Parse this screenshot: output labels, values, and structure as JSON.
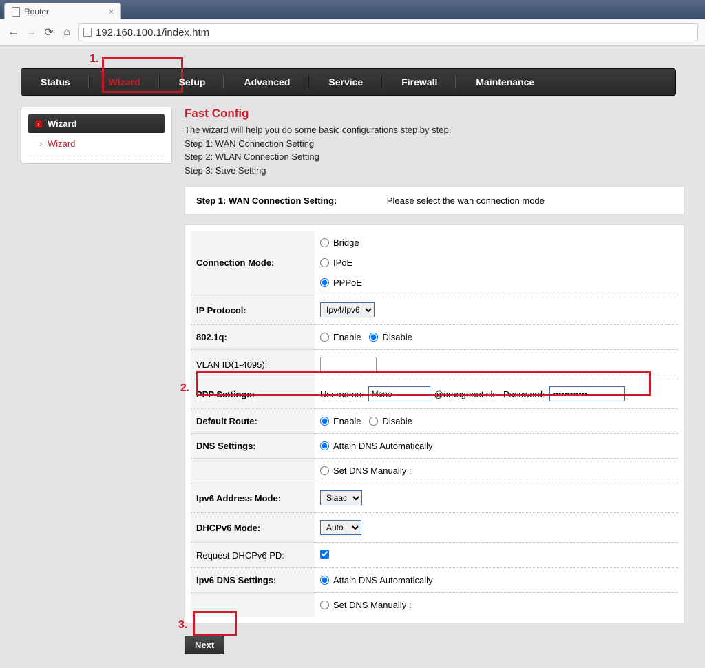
{
  "browser": {
    "tab_title": "Router",
    "url": "192.168.100.1/index.htm"
  },
  "topnav": [
    "Status",
    "Wizard",
    "Setup",
    "Advanced",
    "Service",
    "Firewall",
    "Maintenance"
  ],
  "topnav_active": "Wizard",
  "sidebar": {
    "head": "Wizard",
    "sub": "Wizard"
  },
  "annotations": {
    "one": "1.",
    "two": "2.",
    "three": "3."
  },
  "page": {
    "title": "Fast Config",
    "intro": "The wizard will help you do some basic configurations step by step.",
    "intro_s1": "Step 1: WAN Connection Setting",
    "intro_s2": "Step 2: WLAN Connection Setting",
    "intro_s3": "Step 3: Save Setting",
    "stepbox_left": "Step 1: WAN Connection Setting:",
    "stepbox_right": "Please select the wan connection mode"
  },
  "form": {
    "connection_mode_label": "Connection Mode:",
    "connection_mode_options": {
      "bridge": "Bridge",
      "ipoe": "IPoE",
      "pppoe": "PPPoE"
    },
    "ip_protocol_label": "IP Protocol:",
    "ip_protocol_value": "Ipv4/Ipv6",
    "dot1q_label": "802.1q:",
    "enable": "Enable",
    "disable": "Disable",
    "vlan_label": "VLAN ID(1-4095):",
    "vlan_value": "",
    "ppp_label": "PPP Settings:",
    "ppp_user_label": "Username:",
    "ppp_user_value": "Meno",
    "ppp_domain": "@orangenet.sk",
    "ppp_pass_label": "Password:",
    "ppp_pass_value": "••••••••••••",
    "default_route_label": "Default Route:",
    "dns_label": "DNS Settings:",
    "dns_auto": "Attain DNS Automatically",
    "dns_manual": "Set DNS Manually :",
    "ipv6_addr_label": "Ipv6 Address Mode:",
    "ipv6_addr_value": "Slaac",
    "dhcpv6_label": "DHCPv6 Mode:",
    "dhcpv6_value": "Auto",
    "req_pd_label": "Request DHCPv6 PD:",
    "ipv6_dns_label": "Ipv6 DNS Settings:"
  },
  "buttons": {
    "next": "Next"
  }
}
